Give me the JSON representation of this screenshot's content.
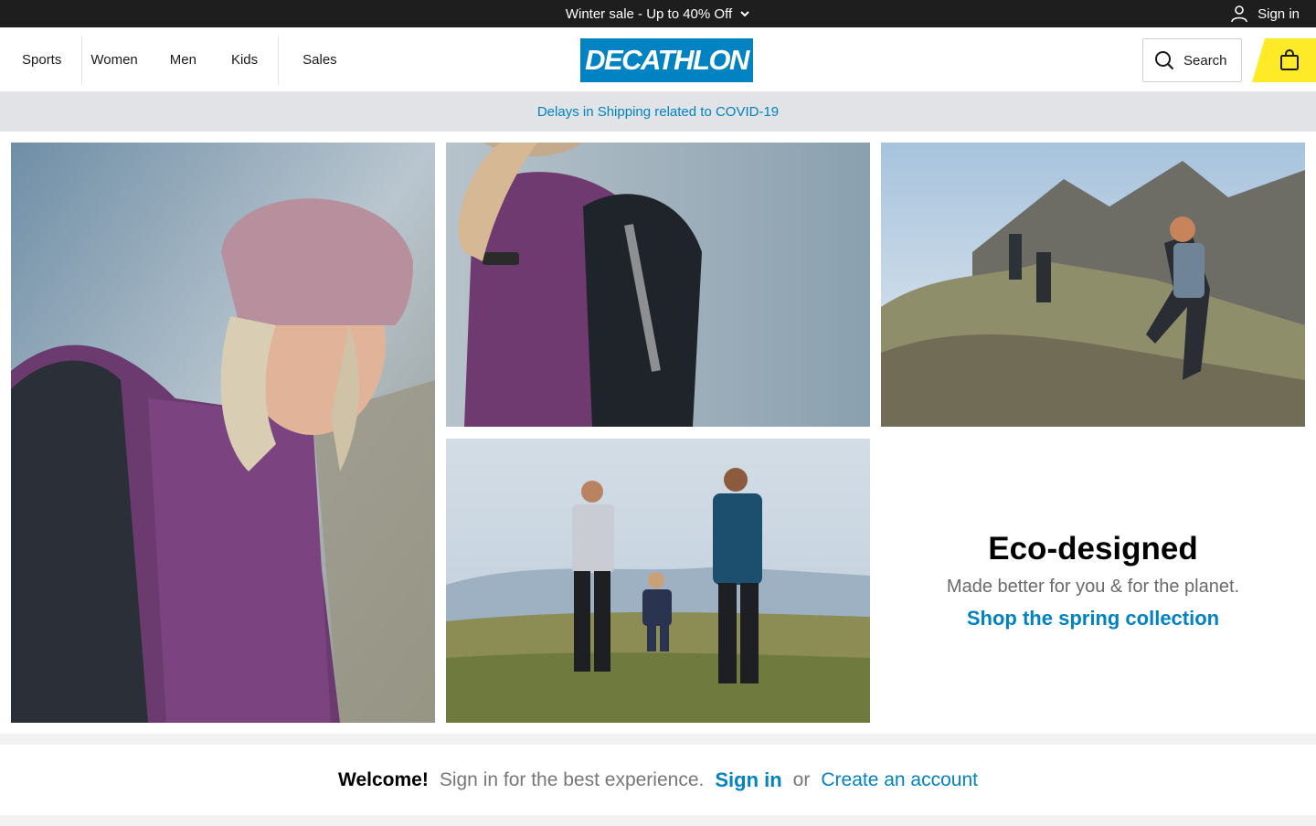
{
  "promo": {
    "text": "Winter sale - Up to 40% Off",
    "icon": "chevron-down-icon"
  },
  "account": {
    "signin_label": "Sign in",
    "icon": "user-icon"
  },
  "nav": {
    "items": [
      "Sports",
      "Women",
      "Men",
      "Kids",
      "Sales"
    ]
  },
  "logo": {
    "text": "DECATHLON",
    "color": "#0082c3"
  },
  "search": {
    "label": "Search",
    "icon": "search-icon"
  },
  "cart": {
    "icon": "shopping-bag-icon",
    "color": "#ffea28"
  },
  "banner": {
    "text": "Delays in Shipping related to COVID-19"
  },
  "hero": {
    "title": "Eco-designed",
    "subtitle": "Made better for you & for the planet.",
    "cta": "Shop the spring collection"
  },
  "welcome": {
    "title": "Welcome!",
    "text": "Sign in for the best experience.",
    "signin": "Sign in",
    "or": "or",
    "create": "Create an account"
  },
  "colors": {
    "brand_blue": "#0082c3",
    "accent_yellow": "#ffea28",
    "dark_bar": "#1e1e1e"
  }
}
